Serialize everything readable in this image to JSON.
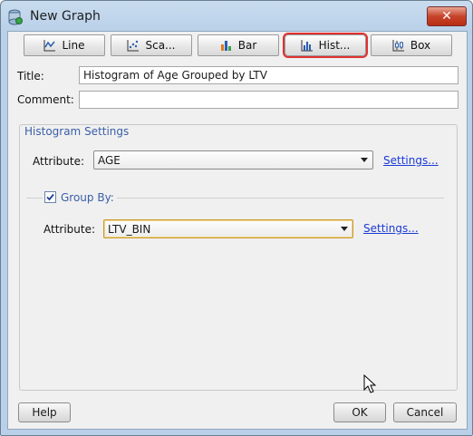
{
  "window": {
    "title": "New Graph",
    "close_label": "✕"
  },
  "toolbar": {
    "buttons": [
      {
        "label": "Line",
        "icon": "line-chart-icon"
      },
      {
        "label": "Sca...",
        "icon": "scatter-chart-icon"
      },
      {
        "label": "Bar",
        "icon": "bar-chart-icon"
      },
      {
        "label": "Hist...",
        "icon": "histogram-icon",
        "selected": true
      },
      {
        "label": "Box",
        "icon": "box-plot-icon"
      }
    ]
  },
  "form": {
    "title_label": "Title:",
    "title_value": "Histogram of Age Grouped by LTV",
    "comment_label": "Comment:",
    "comment_value": ""
  },
  "histogram_settings": {
    "section_title": "Histogram Settings",
    "attribute_label": "Attribute:",
    "attribute_value": "AGE",
    "settings_link": "Settings...",
    "group_by": {
      "label": "Group By:",
      "checked": true,
      "attribute_label": "Attribute:",
      "attribute_value": "LTV_BIN",
      "settings_link": "Settings..."
    }
  },
  "footer": {
    "help_label": "Help",
    "ok_label": "OK",
    "cancel_label": "Cancel"
  },
  "colors": {
    "highlight": "#e03131",
    "link": "#1a3ad6",
    "section_title": "#3a5ea8"
  }
}
